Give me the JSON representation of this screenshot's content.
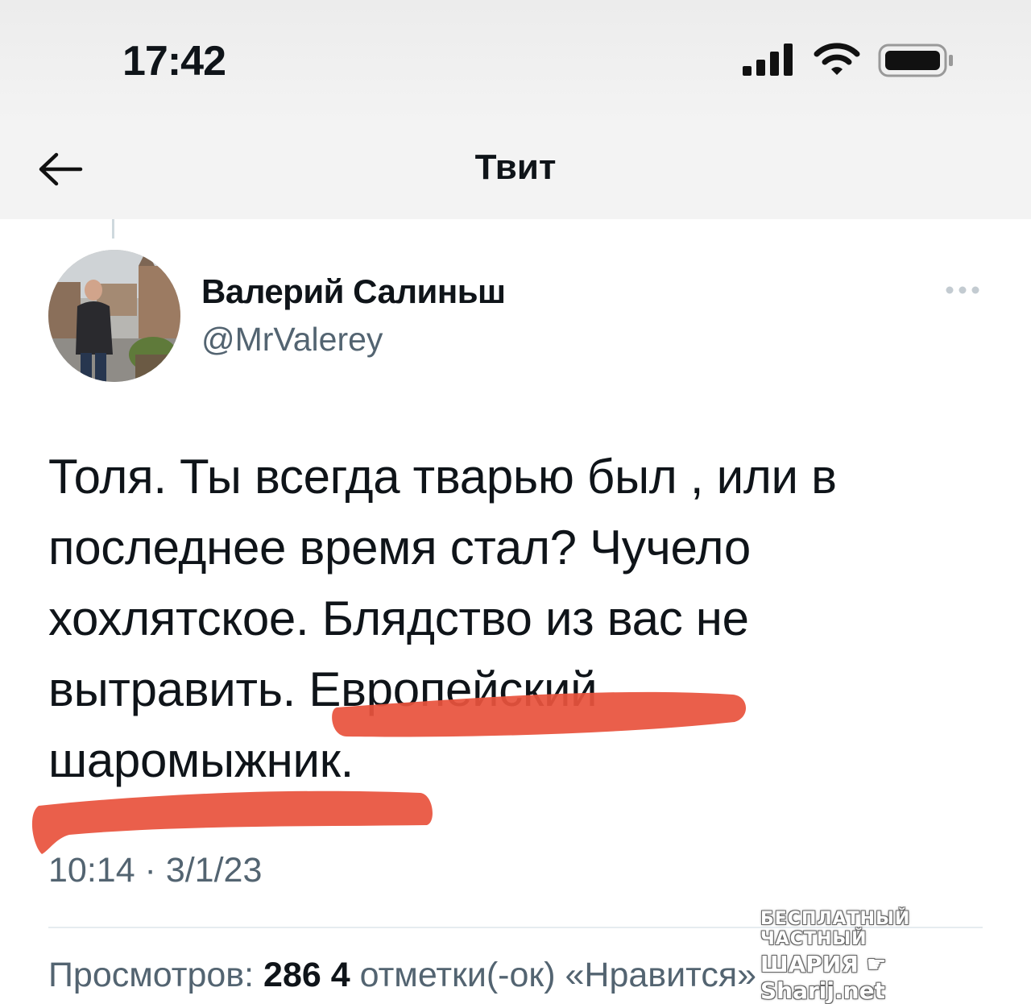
{
  "status_bar": {
    "time": "17:42"
  },
  "header": {
    "title": "Твит"
  },
  "tweet": {
    "author_name": "Валерий Салиньш",
    "author_handle": "@MrValerey",
    "text": "Толя. Ты всегда тварью был , или в\nпоследнее время стал? Чучело\nхохлятское. Блядство из вас не\nвытравить. Европейский\nшаромыжник.",
    "timestamp": "10:14 · 3/1/23"
  },
  "stats": {
    "views_label": "Просмотров:",
    "views_value": "286",
    "likes_value": "4",
    "likes_label": "отметки(-ок) «Нравится»"
  },
  "watermark": {
    "line1": "БЕСПЛАТНЫЙ ЧАСТНЫЙ",
    "line2_a": "ШАРИЯ",
    "line2_b": "Sharij.net"
  },
  "colors": {
    "highlight": "#e8533d",
    "secondary_text": "#536471",
    "primary_text": "#0f1419"
  }
}
